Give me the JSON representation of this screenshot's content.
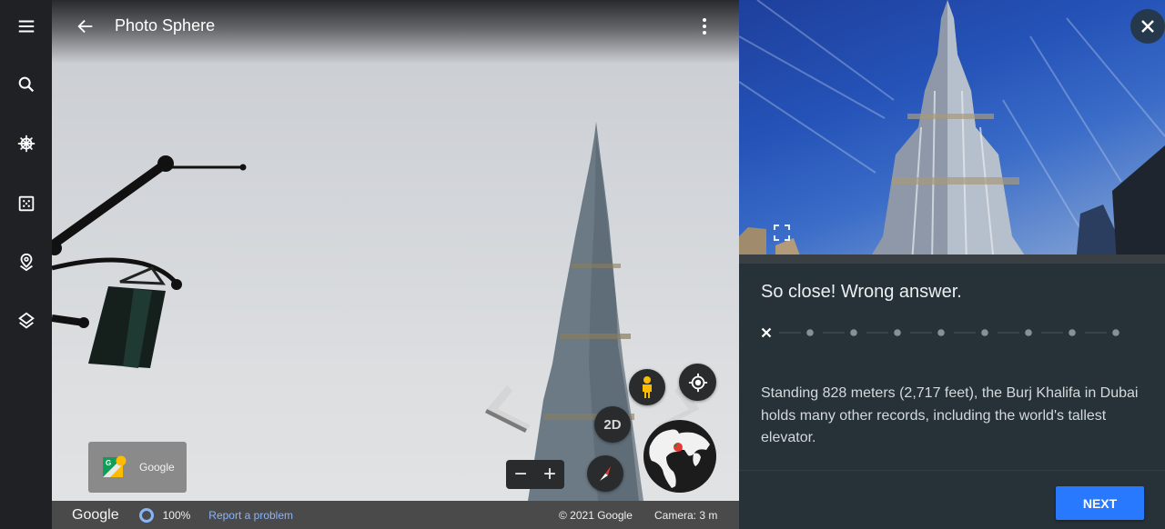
{
  "sidebar": {
    "items": [
      {
        "icon": "menu-icon",
        "label": "Menu"
      },
      {
        "icon": "search-icon",
        "label": "Search"
      },
      {
        "icon": "ship-wheel-icon",
        "label": "Explore"
      },
      {
        "icon": "dice-icon",
        "label": "I'm feeling curious"
      },
      {
        "icon": "place-pin-icon",
        "label": "Voyager"
      },
      {
        "icon": "layers-icon",
        "label": "Map style"
      }
    ]
  },
  "streetview": {
    "title": "Photo Sphere",
    "attribution_name": "Google",
    "mode_button": "2D",
    "zoom_out": "−",
    "zoom_in": "+",
    "footer": {
      "logo": "Google",
      "progress_percent": "100%",
      "report_link": "Report a problem",
      "copyright": "© 2021 Google",
      "camera": "Camera: 3 m"
    }
  },
  "quiz": {
    "result_title": "So close! Wrong answer.",
    "progress": {
      "total_questions": 9,
      "current": 1,
      "answers": [
        "wrong",
        "pending",
        "pending",
        "pending",
        "pending",
        "pending",
        "pending",
        "pending",
        "pending"
      ]
    },
    "description": "Standing 828 meters (2,717 feet), the Burj Khalifa in Dubai holds many other records, including the world's tallest elevator.",
    "next_label": "NEXT"
  },
  "colors": {
    "accent": "#2979ff",
    "panel_bg": "#263238",
    "rail_bg": "#202124",
    "link": "#8ab4f8",
    "pegman": "#fbbc04"
  }
}
